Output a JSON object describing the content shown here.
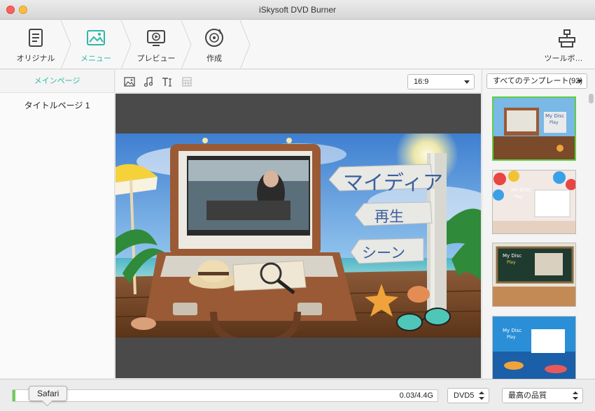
{
  "window": {
    "title": "iSkysoft DVD Burner"
  },
  "toolbar": {
    "steps": [
      {
        "label": "オリジナル",
        "icon": "document-icon",
        "active": false
      },
      {
        "label": "メニュー",
        "icon": "image-frame-icon",
        "active": true
      },
      {
        "label": "プレビュー",
        "icon": "play-screen-icon",
        "active": false
      },
      {
        "label": "作成",
        "icon": "disc-burn-icon",
        "active": false
      }
    ],
    "tools_label": "ツールボ…"
  },
  "left_panel": {
    "header": "メインページ",
    "items": [
      {
        "label": "タイトルページ  1"
      }
    ]
  },
  "sub_toolbar": {
    "icons": [
      "background-image-icon",
      "music-note-icon",
      "text-icon",
      "frame-icon"
    ],
    "aspect_ratio": "16:9"
  },
  "preview": {
    "menu_title": "マイディア",
    "menu_play": "再生",
    "menu_scenes": "シーン"
  },
  "templates": {
    "filter": "すべてのテンプレート(92)",
    "items": [
      {
        "name": "My Disc",
        "sub": "Play",
        "theme": "beach",
        "selected": true
      },
      {
        "name": "MY DISC",
        "sub": "Play",
        "theme": "balloons",
        "selected": false
      },
      {
        "name": "My Disc",
        "sub": "Play",
        "theme": "chalkboard",
        "selected": false
      },
      {
        "name": "My Disc",
        "sub": "Play",
        "theme": "ocean",
        "selected": false
      }
    ]
  },
  "bottom": {
    "capacity_text": "0.03/4.4G",
    "progress_fraction": 0.007,
    "disc_type": "DVD5",
    "quality": "最高の品質",
    "tooltip": "Safari"
  },
  "colors": {
    "accent": "#2fb8a4",
    "selection": "#5fce3f",
    "progress": "#6fcf5a"
  }
}
